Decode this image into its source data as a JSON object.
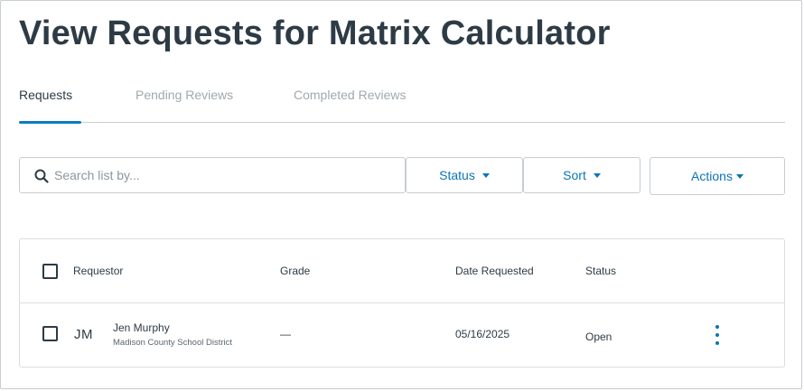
{
  "page": {
    "title": "View Requests for Matrix Calculator"
  },
  "tabs": [
    {
      "label": "Requests",
      "active": true
    },
    {
      "label": "Pending Reviews",
      "active": false
    },
    {
      "label": "Completed Reviews",
      "active": false
    }
  ],
  "toolbar": {
    "search_placeholder": "Search list by...",
    "status_label": "Status",
    "sort_label": "Sort",
    "actions_label": "Actions"
  },
  "table": {
    "columns": [
      "Requestor",
      "Grade",
      "Date Requested",
      "Status"
    ],
    "rows": [
      {
        "initials": "JM",
        "name": "Jen Murphy",
        "organization": "Madison County School District",
        "grade": "—",
        "date_requested": "05/16/2025",
        "status": "Open"
      }
    ]
  },
  "colors": {
    "accent": "#0b74b8",
    "text": "#2d3b45",
    "muted": "#a0a8ae",
    "border": "#c7cdd1"
  },
  "icons": {
    "search": "search-icon",
    "caret": "caret-down-icon",
    "row_menu": "kebab-menu-icon"
  }
}
